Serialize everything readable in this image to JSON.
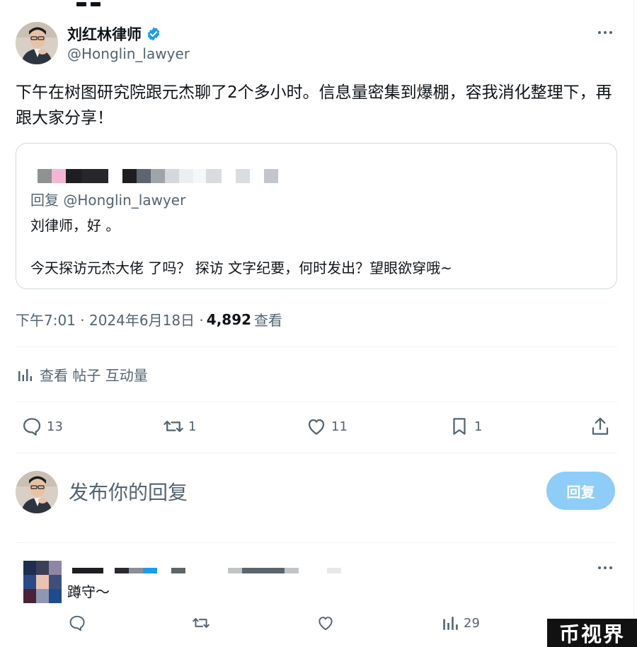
{
  "author": {
    "name": "刘红林律师",
    "handle": "@Honglin_lawyer"
  },
  "tweet": {
    "text": "下午在树图研究院跟元杰聊了2个多小时。信息量密集到爆棚，容我消化整理下，再跟大家分享！"
  },
  "quote": {
    "reply_to": "回复 @Honglin_lawyer",
    "line1": "刘律师，好 。",
    "line2": "今天探访元杰大佬 了吗？ 探访 文字纪要，何时发出？望眼欲穿哦~"
  },
  "meta": {
    "time": "下午7:01 · 2024年6月18日 · ",
    "views_count": "4,892",
    "views_label": " 查看"
  },
  "engagement_link": "查看 帖子 互动量",
  "actions": {
    "reply_count": "13",
    "retweet_count": "1",
    "like_count": "11",
    "bookmark_count": "1"
  },
  "composer": {
    "placeholder": "发布你的回复",
    "reply_button": "回复"
  },
  "comment": {
    "text": "蹲守～",
    "views_count": "29"
  },
  "watermark": "币视界",
  "colors": {
    "accent": "#1d9bf0",
    "reply_button_disabled": "#8ecdf8",
    "secondary_text": "#536471"
  }
}
